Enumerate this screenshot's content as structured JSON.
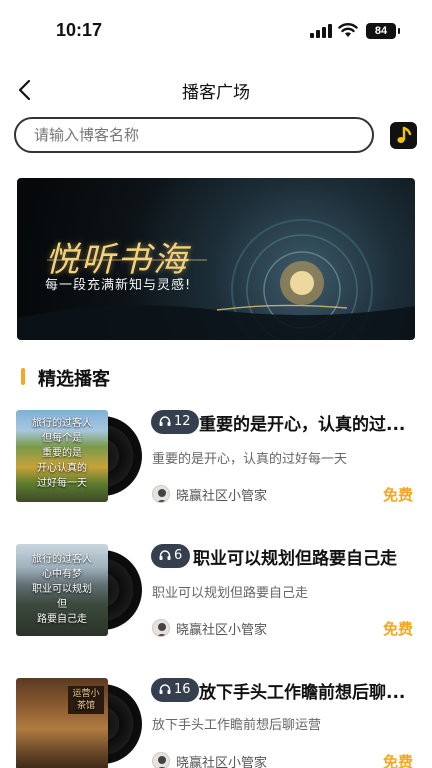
{
  "status_bar": {
    "time": "10:17",
    "battery": "84"
  },
  "header": {
    "title": "播客广场"
  },
  "search": {
    "placeholder": "请输入博客名称"
  },
  "banner": {
    "title": "悦听书海",
    "subtitle": "每一段充满新知与灵感!"
  },
  "section": {
    "title": "精选播客"
  },
  "podcasts": [
    {
      "plays": "12",
      "title": "重要的是开心，认真的过...",
      "desc": "重要的是开心，认真的过好每一天",
      "author": "晓赢社区小管家",
      "price": "免费",
      "cover_text": "旅行的过客人\n但每个是\n重要的是\n开心认真的\n过好每一天"
    },
    {
      "plays": "6",
      "title": "职业可以规划但路要自己走",
      "desc": "职业可以规划但路要自己走",
      "author": "晓赢社区小管家",
      "price": "免费",
      "cover_text": "旅行的过客人\n心中有梦\n职业可以规划\n但\n路要自己走"
    },
    {
      "plays": "16",
      "title": "放下手头工作瞻前想后聊...",
      "desc": "放下手头工作瞻前想后聊运营",
      "author": "晓赢社区小管家",
      "price": "免费",
      "cover_text": "运营小茶馆"
    }
  ],
  "colors": {
    "accent": "#f5a623",
    "badge_bg": "#353f4e",
    "text_primary": "#111111"
  }
}
